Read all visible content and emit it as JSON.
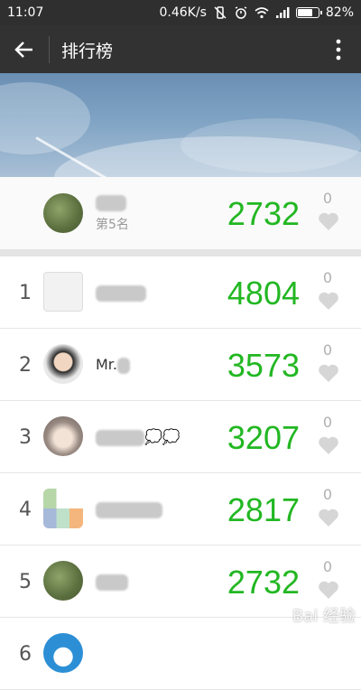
{
  "status_bar": {
    "time": "11:07",
    "network_speed": "0.46K/s",
    "battery": "82%",
    "battery_level": 0.82
  },
  "app_bar": {
    "title": "排行榜",
    "back_icon": "arrow-left-icon",
    "more_icon": "more-vertical-icon"
  },
  "my_rank": {
    "name": "",
    "position_text": "第5名",
    "score": "2732",
    "likes": "0"
  },
  "ranking": [
    {
      "rank": "1",
      "name": "",
      "score": "4804",
      "likes": "0"
    },
    {
      "rank": "2",
      "name": "Mr.",
      "score": "3573",
      "likes": "0"
    },
    {
      "rank": "3",
      "name": "",
      "score": "3207",
      "likes": "0"
    },
    {
      "rank": "4",
      "name": "",
      "score": "2817",
      "likes": "0"
    },
    {
      "rank": "5",
      "name": "",
      "score": "2732",
      "likes": "0"
    },
    {
      "rank": "6",
      "name": "",
      "score": "",
      "likes": ""
    }
  ],
  "watermark": "Bai 经验",
  "colors": {
    "score_green": "#22b722",
    "app_bar": "#323232",
    "status_bar": "#2f2f2f"
  }
}
